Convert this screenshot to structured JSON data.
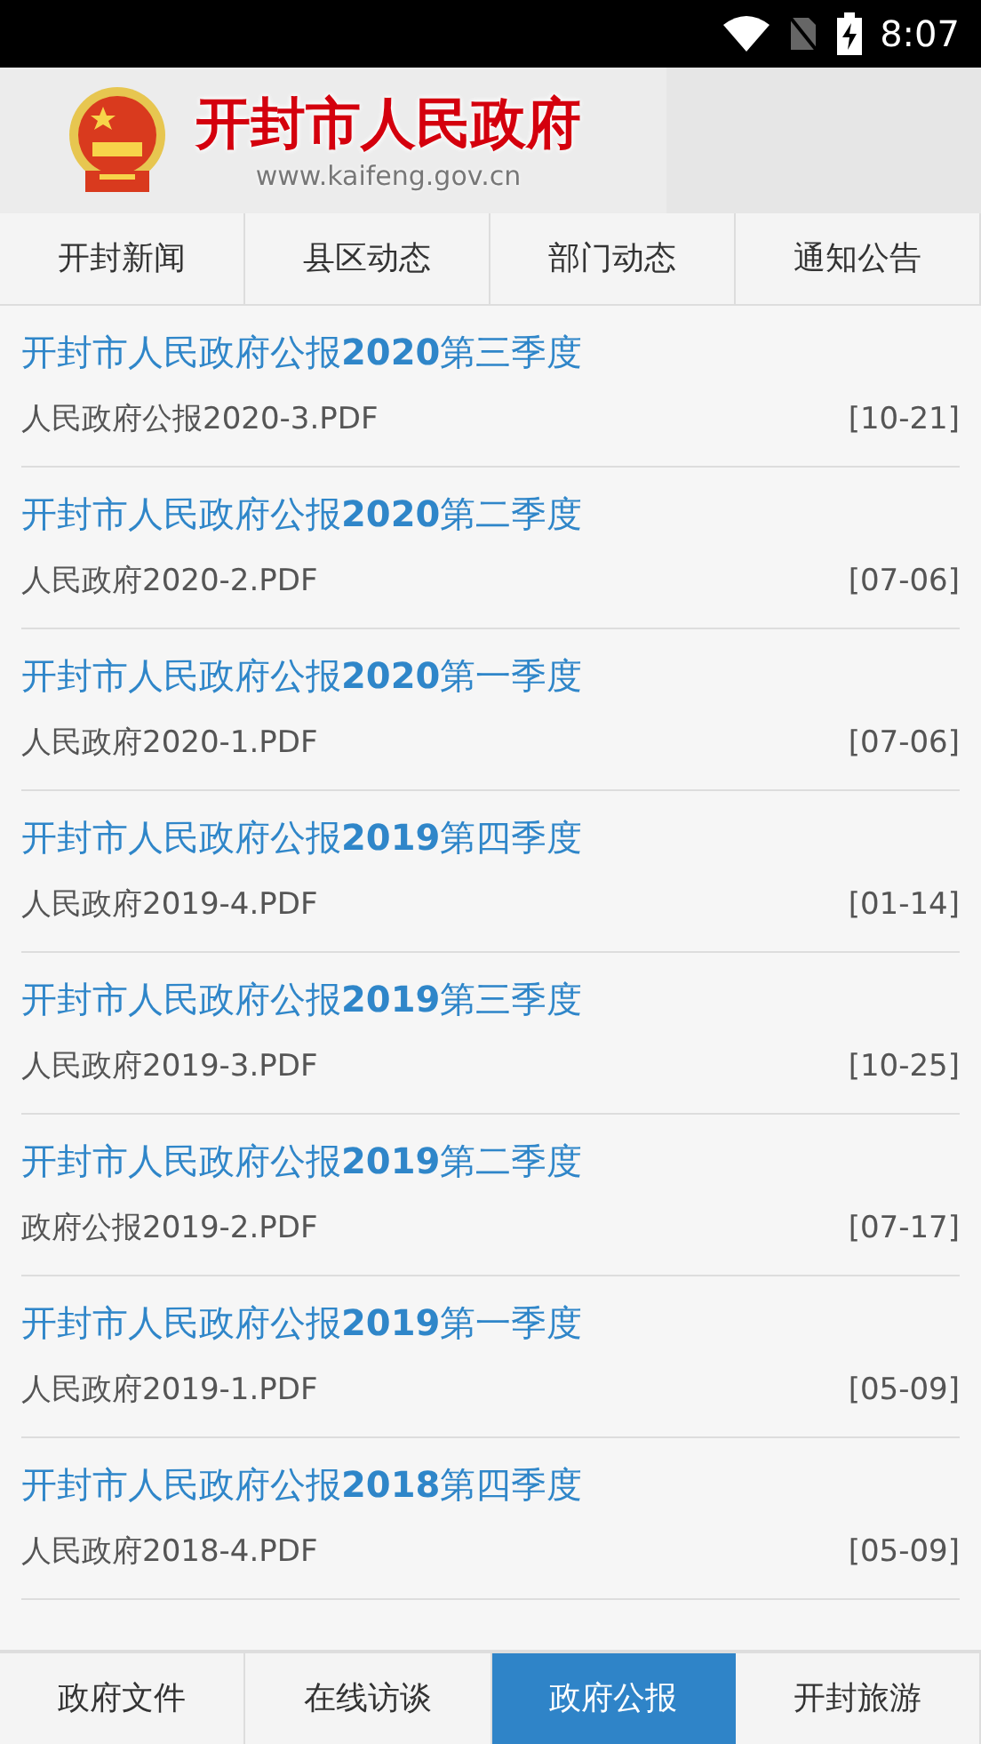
{
  "status_bar": {
    "time": "8:07"
  },
  "header": {
    "title": "开封市人民政府",
    "url": "www.kaifeng.gov.cn"
  },
  "top_tabs": [
    {
      "label": "开封新闻"
    },
    {
      "label": "县区动态"
    },
    {
      "label": "部门动态"
    },
    {
      "label": "通知公告"
    }
  ],
  "items": [
    {
      "title": "开封市人民政府公报**2020**第三季度",
      "file": "人民政府公报2020-3.PDF",
      "date": "[10-21]"
    },
    {
      "title": "开封市人民政府公报**2020**第二季度",
      "file": "人民政府2020-2.PDF",
      "date": "[07-06]"
    },
    {
      "title": "开封市人民政府公报**2020**第一季度",
      "file": "人民政府2020-1.PDF",
      "date": "[07-06]"
    },
    {
      "title": "开封市人民政府公报**2019**第四季度",
      "file": "人民政府2019-4.PDF",
      "date": "[01-14]"
    },
    {
      "title": "开封市人民政府公报**2019**第三季度",
      "file": "人民政府2019-3.PDF",
      "date": "[10-25]"
    },
    {
      "title": "开封市人民政府公报**2019**第二季度",
      "file": "政府公报2019-2.PDF",
      "date": "[07-17]"
    },
    {
      "title": "开封市人民政府公报**2019**第一季度",
      "file": "人民政府2019-1.PDF",
      "date": "[05-09]"
    },
    {
      "title": "开封市人民政府公报**2018**第四季度",
      "file": "人民政府2018-4.PDF",
      "date": "[05-09]"
    }
  ],
  "bottom_tabs": [
    {
      "label": "政府文件",
      "selected": false
    },
    {
      "label": "在线访谈",
      "selected": false
    },
    {
      "label": "政府公报",
      "selected": true
    },
    {
      "label": "开封旅游",
      "selected": false
    }
  ]
}
